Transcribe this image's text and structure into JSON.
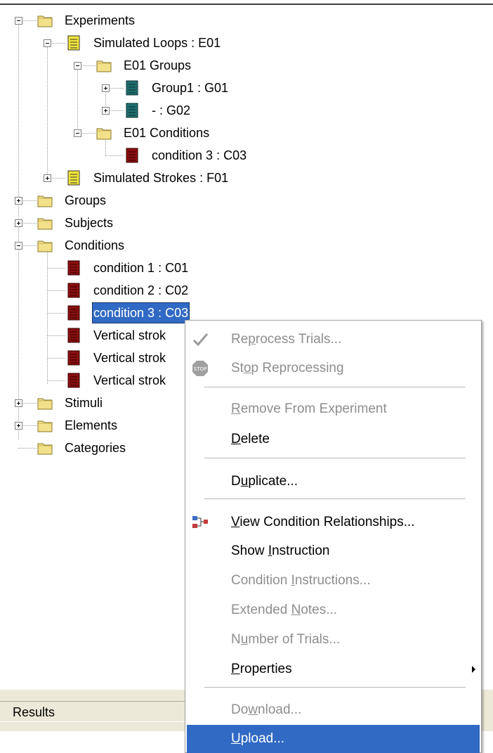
{
  "tree": {
    "experiments": "Experiments",
    "simulated_loops": "Simulated Loops : E01",
    "e01_groups": "E01 Groups",
    "group1": "Group1 : G01",
    "group2": "- : G02",
    "e01_conditions": "E01 Conditions",
    "e01_condition3": "condition 3 : C03",
    "simulated_strokes": "Simulated Strokes : F01",
    "groups": "Groups",
    "subjects": "Subjects",
    "conditions": "Conditions",
    "condition1": "condition 1 : C01",
    "condition2": "condition 2 : C02",
    "condition3": "condition 3 : C03",
    "vertical1": "Vertical strok",
    "vertical2": "Vertical strok",
    "vertical3": "Vertical strok",
    "stimuli": "Stimuli",
    "elements": "Elements",
    "categories": "Categories"
  },
  "status": {
    "results": "Results"
  },
  "menu": {
    "reprocess_pre": "Re",
    "reprocess_u": "p",
    "reprocess_post": "rocess Trials...",
    "stop_pre": "St",
    "stop_u": "o",
    "stop_post": "p Reprocessing",
    "remove_pre": "",
    "remove_u": "R",
    "remove_post": "emove From Experiment",
    "delete_pre": "",
    "delete_u": "D",
    "delete_post": "elete",
    "duplicate_pre": "D",
    "duplicate_u": "u",
    "duplicate_post": "plicate...",
    "view_pre": "",
    "view_u": "V",
    "view_post": "iew Condition Relationships...",
    "show_pre": "Show ",
    "show_u": "I",
    "show_post": "nstruction",
    "condinstr_pre": "Condition ",
    "condinstr_u": "I",
    "condinstr_post": "nstructions...",
    "notes_pre": "Extended ",
    "notes_u": "N",
    "notes_post": "otes...",
    "numtrials_pre": "N",
    "numtrials_u": "u",
    "numtrials_post": "mber of Trials...",
    "props_pre": "",
    "props_u": "P",
    "props_post": "roperties",
    "download_pre": "Do",
    "download_u": "w",
    "download_post": "nload...",
    "upload_pre": "",
    "upload_u": "U",
    "upload_post": "pload..."
  },
  "colors": {
    "selection": "#316ac5",
    "folder": "#f3e08a",
    "exp_doc": "#f2e53a",
    "group_doc": "#1f6e6e",
    "cond_doc": "#8a0f0f"
  }
}
